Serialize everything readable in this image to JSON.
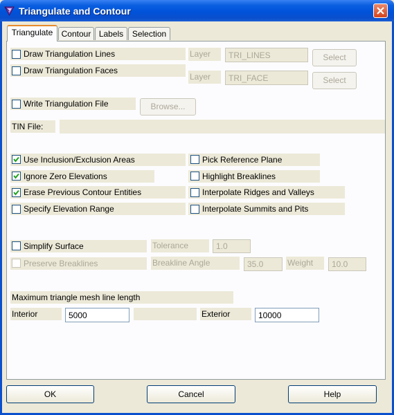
{
  "window": {
    "title": "Triangulate and Contour"
  },
  "tabs": [
    "Triangulate",
    "Contour",
    "Labels",
    "Selection"
  ],
  "lines": {
    "draw_lines_label": "Draw Triangulation Lines",
    "draw_lines_checked": false,
    "draw_faces_label": "Draw Triangulation Faces",
    "draw_faces_checked": false,
    "layer_label": "Layer",
    "lines_layer_value": "TRI_LINES",
    "faces_layer_value": "TRI_FACE",
    "select_label": "Select"
  },
  "file": {
    "write_label": "Write Triangulation File",
    "write_checked": false,
    "browse_label": "Browse...",
    "tin_label": "TIN File:",
    "tin_value": ""
  },
  "options": {
    "left": [
      {
        "label": "Use Inclusion/Exclusion Areas",
        "checked": true
      },
      {
        "label": "Ignore Zero Elevations",
        "checked": true
      },
      {
        "label": "Erase Previous Contour Entities",
        "checked": true
      },
      {
        "label": "Specify Elevation Range",
        "checked": false
      }
    ],
    "right": [
      {
        "label": "Pick Reference Plane",
        "checked": false
      },
      {
        "label": "Highlight Breaklines",
        "checked": false
      },
      {
        "label": "Interpolate Ridges and Valleys",
        "checked": false
      },
      {
        "label": "Interpolate Summits and Pits",
        "checked": false
      }
    ]
  },
  "simplify": {
    "label": "Simplify Surface",
    "checked": false,
    "tolerance_label": "Tolerance",
    "tolerance_value": "1.0",
    "preserve_label": "Preserve Breaklines",
    "preserve_checked": false,
    "angle_label": "Breakline Angle",
    "angle_value": "35.0",
    "weight_label": "Weight",
    "weight_value": "10.0"
  },
  "mesh": {
    "heading": "Maximum triangle mesh line length",
    "interior_label": "Interior",
    "interior_value": "5000",
    "exterior_label": "Exterior",
    "exterior_value": "10000"
  },
  "buttons": {
    "ok": "OK",
    "cancel": "Cancel",
    "help": "Help"
  },
  "colors": {
    "title_bar": "#0a5fe0",
    "dialog_bg": "#ece9d8",
    "panel_bg": "#fcfcfe",
    "check": "#21a121",
    "close": "#d4431d",
    "active_tab": "#e68b2c"
  }
}
